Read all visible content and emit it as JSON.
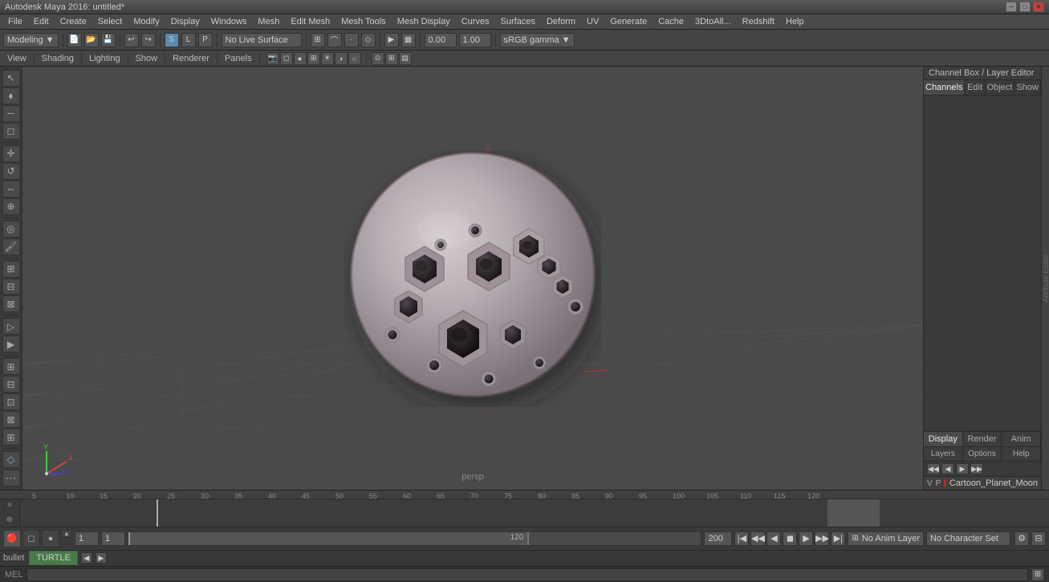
{
  "titleBar": {
    "title": "Autodesk Maya 2016: untitled*",
    "minimize": "─",
    "maximize": "□",
    "close": "✕"
  },
  "menuBar": {
    "items": [
      "File",
      "Edit",
      "Create",
      "Select",
      "Modify",
      "Display",
      "Windows",
      "Mesh",
      "Edit Mesh",
      "Mesh Tools",
      "Mesh Display",
      "Curves",
      "Surfaces",
      "Deform",
      "UV",
      "Generate",
      "Cache",
      "3DtoAll...",
      "Redshift",
      "Help"
    ]
  },
  "toolbar": {
    "workspaceLabel": "Modeling",
    "noLiveSurface": "No Live Surface",
    "fields": [
      {
        "label": "0.00"
      },
      {
        "label": "1.00"
      }
    ],
    "colorSpace": "sRGB gamma"
  },
  "viewportTabs": {
    "items": [
      "View",
      "Shading",
      "Lighting",
      "Show",
      "Renderer",
      "Panels"
    ]
  },
  "viewport": {
    "label": "persp",
    "axes": {
      "x": {
        "color": "#cc3333",
        "label": "X"
      },
      "y": {
        "color": "#33cc33",
        "label": "Y"
      },
      "z": {
        "color": "#3333cc",
        "label": "Z"
      }
    }
  },
  "rightPanel": {
    "header": "Channel Box / Layer Editor",
    "tabs": [
      "Channels",
      "Edit",
      "Object",
      "Show"
    ],
    "bottomTabs": [
      "Display",
      "Render",
      "Anim"
    ],
    "activeBottomTab": "Display",
    "layerToolbarButtons": [
      "<<",
      "<",
      ">",
      ">>"
    ],
    "layerSubTabs": [
      "Layers",
      "Options",
      "Help"
    ],
    "layer": {
      "vLabel": "V",
      "pLabel": "P",
      "colorDot": "#cc3333",
      "name": "Cartoon_Planet_Moon"
    },
    "attrBarLabel": "Attribute Editor"
  },
  "timeline": {
    "rulerMarks": [
      {
        "pos": 30,
        "label": "5"
      },
      {
        "pos": 75,
        "label": "10"
      },
      {
        "pos": 120,
        "label": "15"
      },
      {
        "pos": 165,
        "label": "20"
      },
      {
        "pos": 210,
        "label": "25"
      },
      {
        "pos": 255,
        "label": "30"
      },
      {
        "pos": 300,
        "label": "35"
      },
      {
        "pos": 345,
        "label": "40"
      },
      {
        "pos": 390,
        "label": "45"
      },
      {
        "pos": 435,
        "label": "50"
      },
      {
        "pos": 480,
        "label": "55"
      },
      {
        "pos": 525,
        "label": "60"
      },
      {
        "pos": 570,
        "label": "65"
      },
      {
        "pos": 615,
        "label": "70"
      },
      {
        "pos": 660,
        "label": "75"
      },
      {
        "pos": 705,
        "label": "80"
      },
      {
        "pos": 750,
        "label": "85"
      },
      {
        "pos": 795,
        "label": "90"
      },
      {
        "pos": 840,
        "label": "95"
      },
      {
        "pos": 885,
        "label": "100"
      },
      {
        "pos": 930,
        "label": "105"
      },
      {
        "pos": 975,
        "label": "110"
      },
      {
        "pos": 1020,
        "label": "115"
      },
      {
        "pos": 1065,
        "label": "120"
      }
    ],
    "solver": "bullet",
    "solverType": "TURTLE",
    "transportButtons": [
      "|◀",
      "◀◀",
      "◀",
      "◼",
      "▶",
      "▶▶",
      "▶|"
    ],
    "startFrame": "1",
    "currentFrame": "1",
    "endFrame": "120",
    "rangeStart": "1",
    "rangeEnd": "200",
    "noAnimLayer": "No Anim Layer",
    "noCharSet": "No Character Set"
  },
  "melBar": {
    "label": "MEL"
  }
}
